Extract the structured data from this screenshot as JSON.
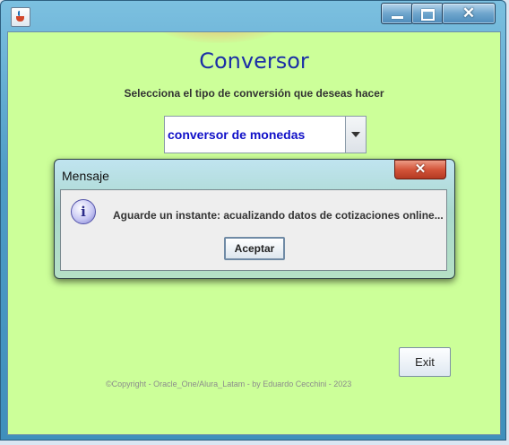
{
  "window": {
    "title": "",
    "controls": {
      "minimize": "minimize",
      "maximize": "maximize",
      "close": "✕"
    }
  },
  "main": {
    "title": "Conversor",
    "subtitle": "Selecciona el tipo de conversión que deseas hacer",
    "converter_select": {
      "selected": "conversor de monedas"
    },
    "exit_label": "Exit",
    "copyright": "©Copyright - Oracle_One/Alura_Latam  - by Eduardo Cecchini - 2023"
  },
  "dialog": {
    "title": "Mensaje",
    "close": "✕",
    "icon": "info-icon",
    "icon_glyph": "i",
    "message": "Aguarde un instante: acualizando datos de cotizaciones online...",
    "ok_label": "Aceptar"
  },
  "colors": {
    "content_bg": "#ccff99",
    "title_color": "#1b2fa6",
    "combo_text": "#1010c8"
  }
}
